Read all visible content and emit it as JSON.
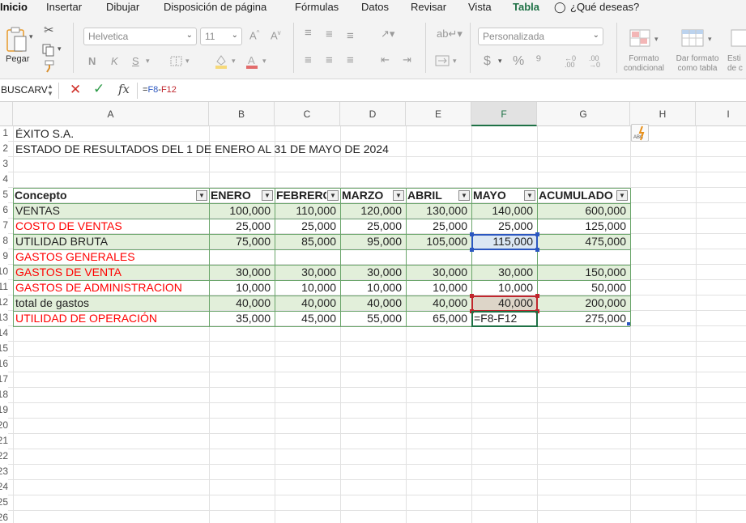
{
  "ribbon_tabs": [
    "Inicio",
    "Insertar",
    "Dibujar",
    "Disposición de página",
    "Fórmulas",
    "Datos",
    "Revisar",
    "Vista",
    "Tabla",
    "¿Qué deseas?"
  ],
  "ribbon": {
    "paste_label": "Pegar",
    "font_name": "Helvetica",
    "font_size": "11",
    "number_format": "Personalizada",
    "bold": "N",
    "italic": "K",
    "underline": "S",
    "currency": "$",
    "percent": "%",
    "thousands": "⁹",
    "conditional_format": "Formato\ncondicional",
    "format_as_table": "Dar formato\ncomo tabla",
    "cell_styles": "Esti\nde c"
  },
  "formula_bar": {
    "name_box": "BUSCARV",
    "fx": "fx",
    "formula_prefix": "=",
    "ref1": "F8",
    "op": "-",
    "ref2": "F12"
  },
  "columns": [
    "A",
    "B",
    "C",
    "D",
    "E",
    "F",
    "G",
    "H",
    "I"
  ],
  "selected_column": "F",
  "row_numbers": [
    "1",
    "2",
    "3",
    "4",
    "5",
    "6",
    "7",
    "8",
    "9",
    "10",
    "11",
    "12",
    "13",
    "14",
    "15",
    "16",
    "17",
    "18",
    "19",
    "20",
    "21",
    "22",
    "23",
    "24",
    "25",
    "26"
  ],
  "sheet": {
    "company": "ÉXITO S.A.",
    "report_title": "ESTADO DE RESULTADOS DEL 1 DE ENERO AL 31 DE MAYO DE 2024",
    "table_headers": [
      "Concepto",
      "ENERO",
      "FEBRERO",
      "MARZO",
      "ABRIL",
      "MAYO",
      "ACUMULADO"
    ],
    "rows": [
      {
        "label": "VENTAS",
        "red": false,
        "values": [
          "100,000",
          "110,000",
          "120,000",
          "130,000",
          "140,000",
          "600,000"
        ]
      },
      {
        "label": "COSTO DE VENTAS",
        "red": true,
        "values": [
          "25,000",
          "25,000",
          "25,000",
          "25,000",
          "25,000",
          "125,000"
        ]
      },
      {
        "label": "UTILIDAD BRUTA",
        "red": false,
        "values": [
          "75,000",
          "85,000",
          "95,000",
          "105,000",
          "115,000",
          "475,000"
        ]
      },
      {
        "label": "GASTOS GENERALES",
        "red": true,
        "values": [
          "",
          "",
          "",
          "",
          "",
          ""
        ]
      },
      {
        "label": "GASTOS DE VENTA",
        "red": true,
        "values": [
          "30,000",
          "30,000",
          "30,000",
          "30,000",
          "30,000",
          "150,000"
        ]
      },
      {
        "label": "GASTOS DE ADMINISTRACION",
        "red": true,
        "values": [
          "10,000",
          "10,000",
          "10,000",
          "10,000",
          "10,000",
          "50,000"
        ]
      },
      {
        "label": "total de gastos",
        "red": false,
        "values": [
          "40,000",
          "40,000",
          "40,000",
          "40,000",
          "40,000",
          "200,000"
        ]
      },
      {
        "label": "UTILIDAD DE OPERACIÓN",
        "red": true,
        "values": [
          "35,000",
          "45,000",
          "55,000",
          "65,000",
          "=F8-F12",
          "275,000"
        ]
      }
    ]
  },
  "colors": {
    "accent_green": "#1e7145",
    "band_green": "#e2efda",
    "ref_blue": "#2b57c0",
    "ref_red": "#c0262d",
    "red_text": "#ff0000"
  }
}
